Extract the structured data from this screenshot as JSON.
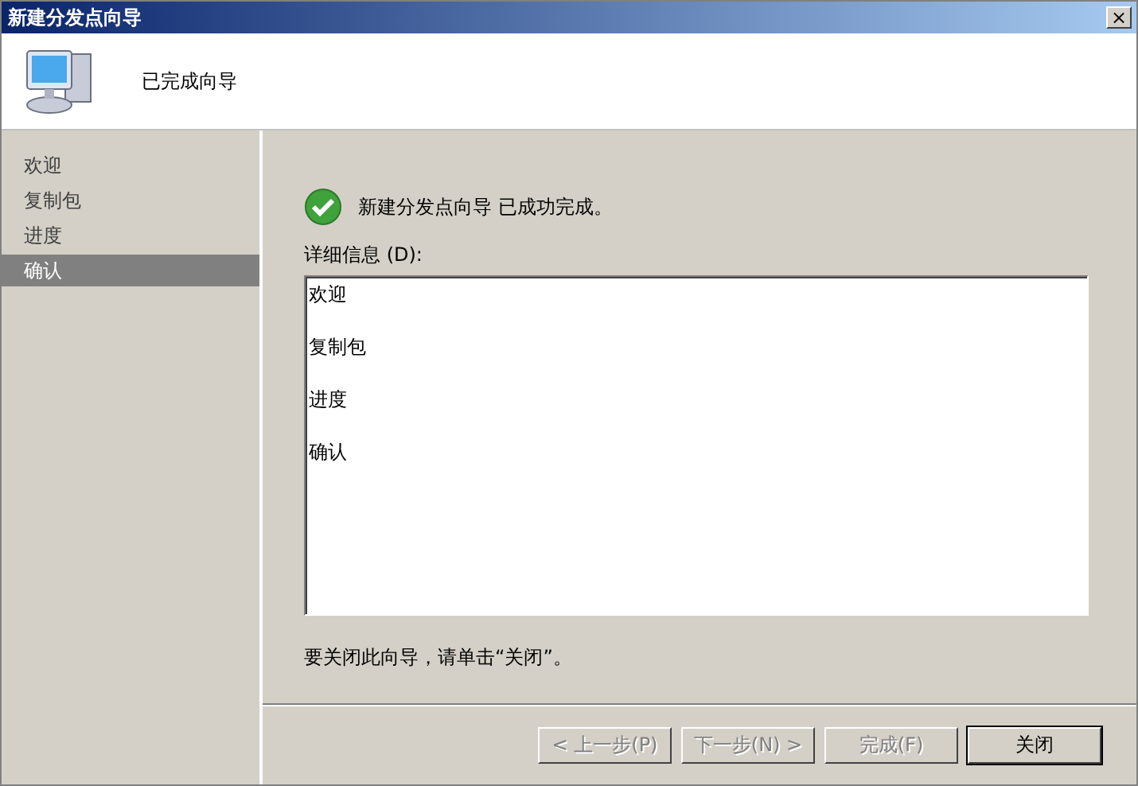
{
  "window": {
    "title": "新建分发点向导",
    "close": "×"
  },
  "header": {
    "title": "已完成向导"
  },
  "sidebar": {
    "items": [
      {
        "label": "欢迎",
        "selected": false
      },
      {
        "label": "复制包",
        "selected": false
      },
      {
        "label": "进度",
        "selected": false
      },
      {
        "label": "确认",
        "selected": true
      }
    ]
  },
  "content": {
    "status": "新建分发点向导 已成功完成。",
    "details_label": "详细信息 (D):",
    "details": [
      "欢迎",
      "复制包",
      "进度",
      "确认"
    ],
    "hint": "要关闭此向导，请单击“关闭”。"
  },
  "buttons": [
    {
      "label": "< 上一步(P)",
      "disabled": true
    },
    {
      "label": "下一步(N) >",
      "disabled": true
    },
    {
      "label": "完成(F)",
      "disabled": true
    },
    {
      "label": "关闭",
      "disabled": false
    }
  ]
}
